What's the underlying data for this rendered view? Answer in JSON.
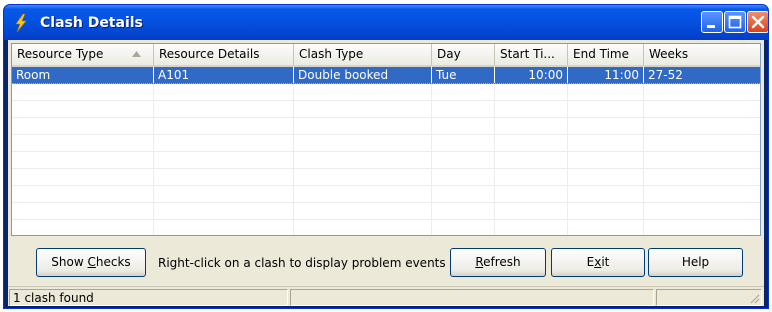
{
  "window": {
    "title": "Clash Details",
    "icon": "lightning-bolt-icon"
  },
  "grid": {
    "columns": [
      "Resource Type",
      "Resource Details",
      "Clash Type",
      "Day",
      "Start Ti...",
      "End Time",
      "Weeks"
    ],
    "sort_column": "Resource Type",
    "sort_direction": "ascending",
    "rows": [
      {
        "resource_type": "Room",
        "resource_details": "A101",
        "clash_type": "Double booked",
        "day": "Tue",
        "start_time": "10:00",
        "end_time": "11:00",
        "weeks": "27-52",
        "selected": true
      }
    ]
  },
  "buttons": {
    "show_checks_pre": "Show ",
    "show_checks_u": "C",
    "show_checks_post": "hecks",
    "refresh_u": "R",
    "refresh_post": "efresh",
    "exit_pre": "E",
    "exit_u": "x",
    "exit_post": "it",
    "help": "Help"
  },
  "hint_text": "Right-click on a clash to display problem events",
  "statusbar": {
    "message": "1 clash found"
  },
  "colors": {
    "selection": "#316ac5",
    "titlebar": "#0553e2",
    "close_button": "#d8431c"
  }
}
